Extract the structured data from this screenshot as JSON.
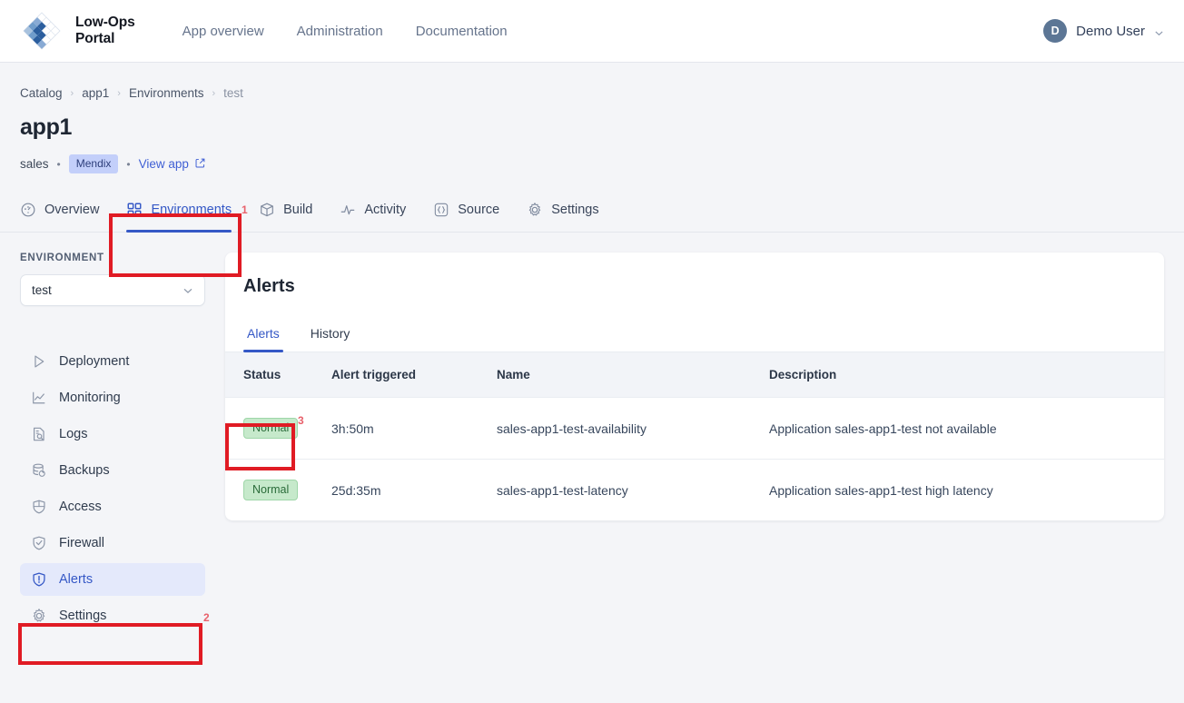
{
  "header": {
    "brand_name": "Low-Ops\nPortal",
    "logo_icon": "diamond-grid-logo",
    "nav": [
      {
        "label": "App overview"
      },
      {
        "label": "Administration"
      },
      {
        "label": "Documentation"
      }
    ],
    "user": {
      "initial": "D",
      "name": "Demo User",
      "caret_icon": "chevron-down-icon"
    }
  },
  "breadcrumb": [
    {
      "label": "Catalog"
    },
    {
      "label": "app1"
    },
    {
      "label": "Environments"
    },
    {
      "label": "test"
    }
  ],
  "page": {
    "title": "app1",
    "owner": "sales",
    "tech_badge": "Mendix",
    "view_app_label": "View app",
    "external_link_icon": "external-link-icon"
  },
  "app_tabs": [
    {
      "label": "Overview",
      "icon": "gauge-icon",
      "active": false
    },
    {
      "label": "Environments",
      "icon": "grid-icon",
      "active": true
    },
    {
      "label": "Build",
      "icon": "box-icon",
      "active": false
    },
    {
      "label": "Activity",
      "icon": "pulse-icon",
      "active": false
    },
    {
      "label": "Source",
      "icon": "braces-icon",
      "active": false
    },
    {
      "label": "Settings",
      "icon": "gear-icon",
      "active": false
    }
  ],
  "sidebar": {
    "section_label": "ENVIRONMENT",
    "env_select": {
      "value": "test",
      "chevron_icon": "chevron-down-icon"
    },
    "items": [
      {
        "label": "Deployment",
        "icon": "play-icon",
        "active": false
      },
      {
        "label": "Monitoring",
        "icon": "chart-line-icon",
        "active": false
      },
      {
        "label": "Logs",
        "icon": "document-search-icon",
        "active": false
      },
      {
        "label": "Backups",
        "icon": "database-refresh-icon",
        "active": false
      },
      {
        "label": "Access",
        "icon": "shield-grid-icon",
        "active": false
      },
      {
        "label": "Firewall",
        "icon": "shield-check-icon",
        "active": false
      },
      {
        "label": "Alerts",
        "icon": "shield-alert-icon",
        "active": true
      },
      {
        "label": "Settings",
        "icon": "gear-icon",
        "active": false
      }
    ]
  },
  "card": {
    "title": "Alerts",
    "subtabs": [
      {
        "label": "Alerts",
        "active": true
      },
      {
        "label": "History",
        "active": false
      }
    ],
    "table": {
      "columns": [
        "Status",
        "Alert triggered",
        "Name",
        "Description"
      ],
      "rows": [
        {
          "status": "Normal",
          "triggered": "3h:50m",
          "name": "sales-app1-test-availability",
          "description": "Application sales-app1-test not available"
        },
        {
          "status": "Normal",
          "triggered": "25d:35m",
          "name": "sales-app1-test-latency",
          "description": "Application sales-app1-test high latency"
        }
      ]
    }
  },
  "annotations": [
    {
      "number": "1",
      "target": "environments-tab"
    },
    {
      "number": "2",
      "target": "sidebar-item-alerts"
    },
    {
      "number": "3",
      "target": "status-column-header"
    }
  ],
  "colors": {
    "accent": "#3558c6",
    "page_bg": "#f4f5f8",
    "badge_green_bg": "#c6e9cb",
    "badge_green_text": "#2a6b39",
    "badge_tech_bg": "#c3cffa",
    "annotation_red": "#e01b24"
  }
}
